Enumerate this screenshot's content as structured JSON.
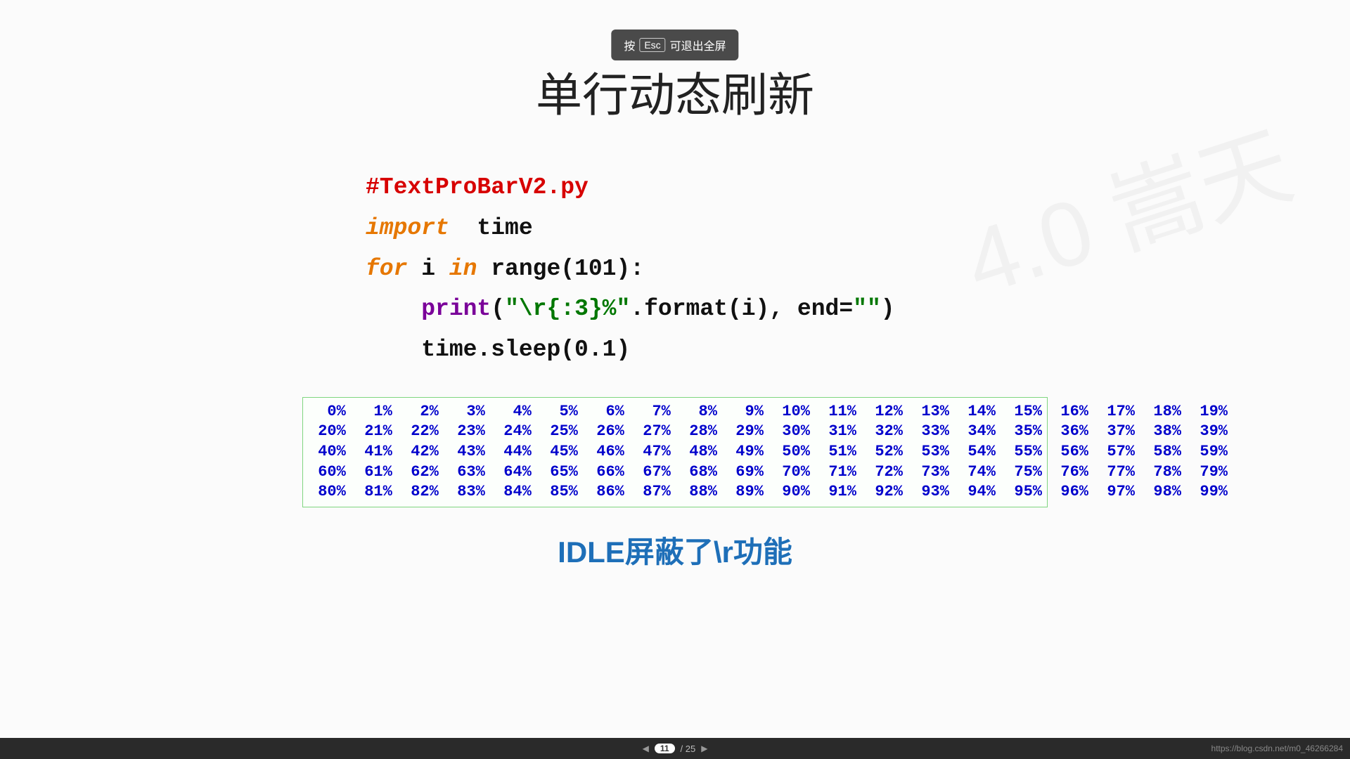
{
  "hint": {
    "before": "按",
    "key": "Esc",
    "after": "可退出全屏"
  },
  "title": "单行动态刷新",
  "code": {
    "l1_comment": "#TextProBarV2.py",
    "l2_kw": "import",
    "l2_rest": "  time",
    "l3_kw1": "for",
    "l3_mid": " i ",
    "l3_kw2": "in",
    "l3_rest": " range(101):",
    "l4_indent": "    ",
    "l4_fn": "print",
    "l4_open": "(",
    "l4_s1": "\"\\r{:3}%\"",
    "l4_mid": ".format(i), end=",
    "l4_s2": "\"\"",
    "l4_close": ")",
    "l5": "    time.sleep(0.1)"
  },
  "output_rows": [
    "  0%   1%   2%   3%   4%   5%   6%   7%   8%   9%  10%  11%  12%  13%  14%  15%  16%  17%  18%  19%",
    " 20%  21%  22%  23%  24%  25%  26%  27%  28%  29%  30%  31%  32%  33%  34%  35%  36%  37%  38%  39%",
    " 40%  41%  42%  43%  44%  45%  46%  47%  48%  49%  50%  51%  52%  53%  54%  55%  56%  57%  58%  59%",
    " 60%  61%  62%  63%  64%  65%  66%  67%  68%  69%  70%  71%  72%  73%  74%  75%  76%  77%  78%  79%",
    " 80%  81%  82%  83%  84%  85%  86%  87%  88%  89%  90%  91%  92%  93%  94%  95%  96%  97%  98%  99%"
  ],
  "note": "IDLE屏蔽了\\r功能",
  "watermark": "4.0 嵩天",
  "nav": {
    "current": "11",
    "total": "/ 25"
  },
  "url": "https://blog.csdn.net/m0_46266284"
}
